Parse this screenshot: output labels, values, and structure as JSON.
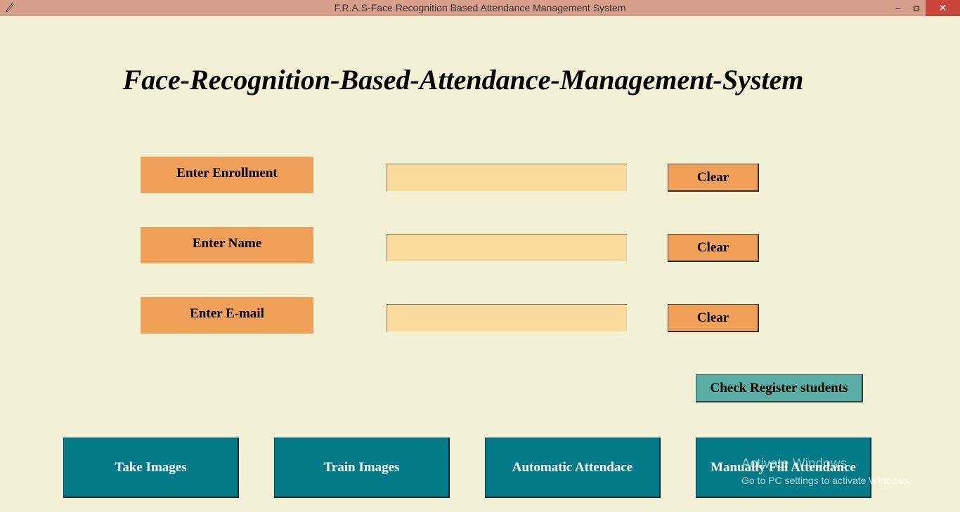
{
  "window": {
    "title": "F.R.A.S-Face Recognition Based Attendance Management System",
    "app_icon": "feather-icon",
    "min_glyph": "–",
    "max_glyph": "⧉",
    "close_glyph": "✕"
  },
  "heading": "Face-Recognition-Based-Attendance-Management-System",
  "form": {
    "rows": [
      {
        "label": "Enter Enrollment",
        "value": "",
        "clear_label": "Clear"
      },
      {
        "label": "Enter Name",
        "value": "",
        "clear_label": "Clear"
      },
      {
        "label": "Enter E-mail",
        "value": "",
        "clear_label": "Clear"
      }
    ]
  },
  "check_register_label": "Check Register students",
  "actions": {
    "take_images": "Take Images",
    "train_images": "Train Images",
    "automatic_attendance": "Automatic Attendace",
    "manual_attendance": "Manually Fill Attendance"
  },
  "watermark": {
    "title": "Activate Windows",
    "subtitle": "Go to PC settings to activate Windows."
  },
  "colors": {
    "background": "#f3f1d5",
    "titlebar": "#d8a08a",
    "label_bg": "#f0a058",
    "entry_bg": "#f8db9c",
    "check_btn": "#5aada2",
    "action_btn": "#027a88"
  }
}
